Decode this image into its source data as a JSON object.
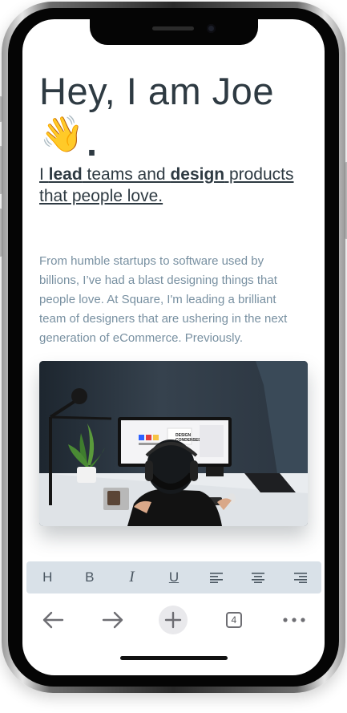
{
  "hero": {
    "title": "Hey, I am Joe",
    "wave_emoji": "👋",
    "title_end": "."
  },
  "tagline": {
    "part1": "I ",
    "bold1": "lead",
    "part2": "  teams and ",
    "bold2": "design",
    "part3": " products that people love."
  },
  "intro": "From humble startups to software used by billions, I’ve had a blast designing things that people love. At Square, I'm leading a brilliant team of designers that are ushering in the next generation of eCommerce. Previously.",
  "photo": {
    "monitor_text_1": "DESIGN",
    "monitor_text_2": "CONDENSED"
  },
  "format_bar": {
    "heading": "H",
    "bold": "B",
    "italic": "I",
    "underline": "U"
  },
  "nav": {
    "tabs_count": "4"
  },
  "icons": [
    "back-arrow-icon",
    "forward-arrow-icon",
    "plus-icon",
    "tabs-icon",
    "more-icon",
    "align-left-icon",
    "align-center-icon",
    "align-right-icon"
  ],
  "colors": {
    "heading": "#2e3a42",
    "body_text": "#7890a1",
    "toolbar_bg": "#d9e1e8"
  }
}
